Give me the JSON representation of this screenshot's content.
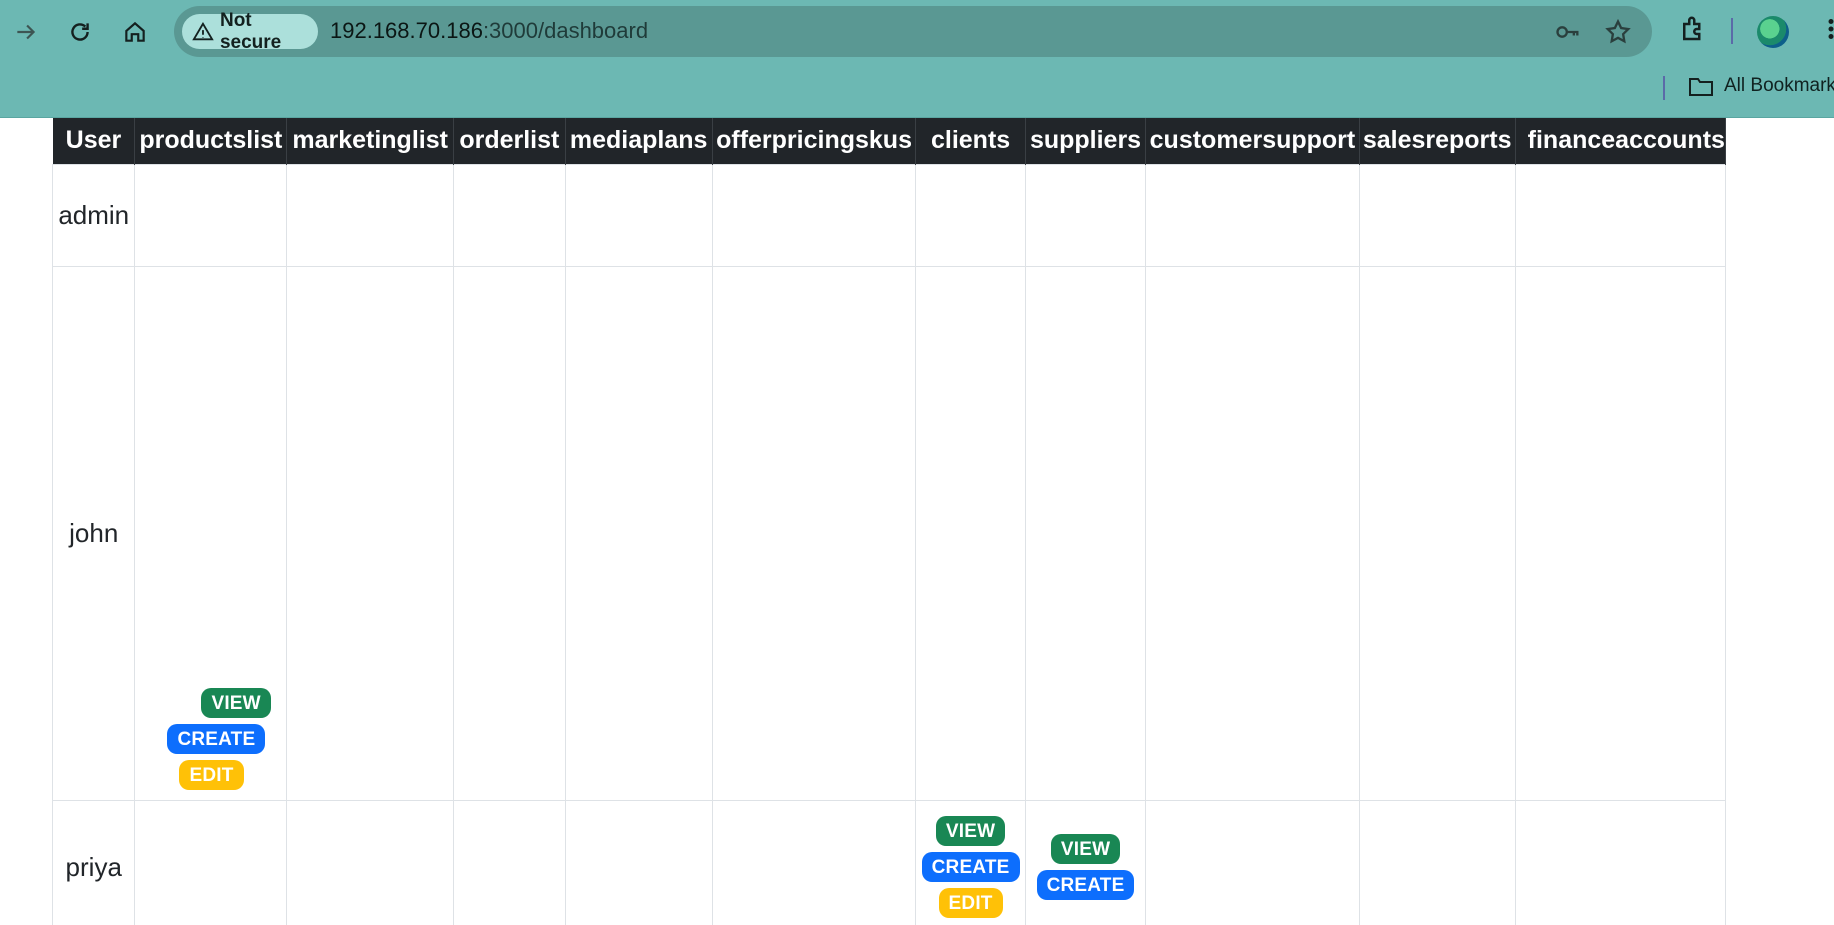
{
  "browser": {
    "security_label": "Not secure",
    "url_host": "192.168.70.186",
    "url_path": ":3000/dashboard",
    "bookmarks_label": "All Bookmarks",
    "icons": [
      "forward-icon",
      "reload-icon",
      "home-icon",
      "warning-icon",
      "key-icon",
      "star-icon",
      "extensions-icon",
      "profile-avatar",
      "menu-icon",
      "folder-icon"
    ]
  },
  "table": {
    "headers": [
      "User",
      "productslist",
      "marketinglist",
      "orderlist",
      "mediaplans",
      "offerpricingskus",
      "clients",
      "suppliers",
      "customersupport",
      "salesreports",
      "financeaccounts"
    ],
    "rows": [
      {
        "user": "admin"
      },
      {
        "user": "john"
      },
      {
        "user": "priya"
      }
    ],
    "badges": {
      "view": "VIEW",
      "create": "CREATE",
      "edit": "EDIT"
    },
    "permissions": {
      "john": {
        "productslist": [
          "VIEW",
          "CREATE",
          "EDIT"
        ]
      },
      "priya": {
        "clients": [
          "VIEW",
          "CREATE",
          "EDIT"
        ],
        "suppliers": [
          "VIEW",
          "CREATE"
        ]
      }
    }
  },
  "colors": {
    "chrome": "#6cb8b3",
    "header_bg": "#212529",
    "view": "#198754",
    "create": "#0d6efd",
    "edit": "#ffc107"
  }
}
